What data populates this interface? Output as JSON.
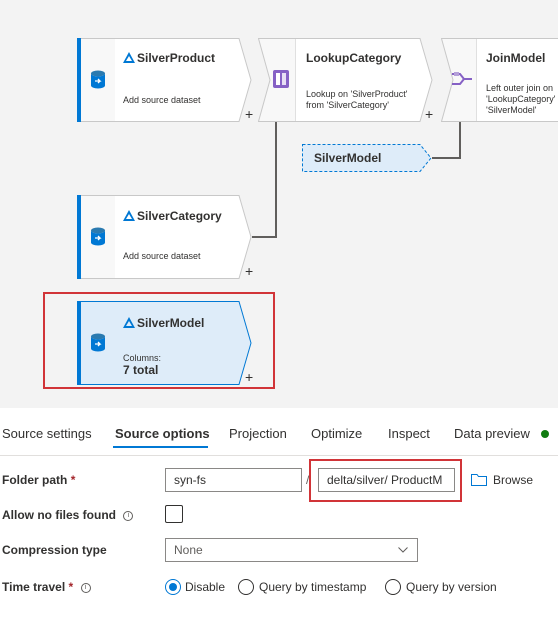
{
  "canvas": {
    "nodes": {
      "silver_product": {
        "title": "SilverProduct",
        "subtitle": "Add source dataset"
      },
      "lookup_category": {
        "title": "LookupCategory",
        "desc_line1": "Lookup on 'SilverProduct'",
        "desc_line2": "from 'SilverCategory'"
      },
      "join_model": {
        "title": "JoinModel",
        "desc_line1": "Left outer join on",
        "desc_line2": "'LookupCategory' and",
        "desc_line3": "'SilverModel'"
      },
      "silver_category": {
        "title": "SilverCategory",
        "subtitle": "Add source dataset"
      },
      "silver_model": {
        "title": "SilverModel",
        "columns_label": "Columns:",
        "columns_value": "7 total"
      }
    },
    "reference_pill": "SilverModel",
    "plus_glyph": "+"
  },
  "tabs": [
    {
      "label": "Source settings",
      "active": false
    },
    {
      "label": "Source options",
      "active": true
    },
    {
      "label": "Projection",
      "active": false
    },
    {
      "label": "Optimize",
      "active": false
    },
    {
      "label": "Inspect",
      "active": false
    },
    {
      "label": "Data preview",
      "active": false
    }
  ],
  "form": {
    "folder_path": {
      "label": "Folder path",
      "required_mark": "*",
      "container": "syn-fs",
      "separator": "/",
      "path": "delta/silver/ ProductM",
      "browse_label": "Browse"
    },
    "allow_no_files": {
      "label": "Allow no files found",
      "info": "i"
    },
    "compression_type": {
      "label": "Compression type",
      "value": "None"
    },
    "time_travel": {
      "label": "Time travel",
      "required_mark": "*",
      "info": "i",
      "options": [
        "Disable",
        "Query by timestamp",
        "Query by version"
      ],
      "selected": "Disable"
    }
  },
  "colors": {
    "accent": "#0078d4",
    "highlight": "#d13438",
    "status_ok": "#107c10"
  }
}
